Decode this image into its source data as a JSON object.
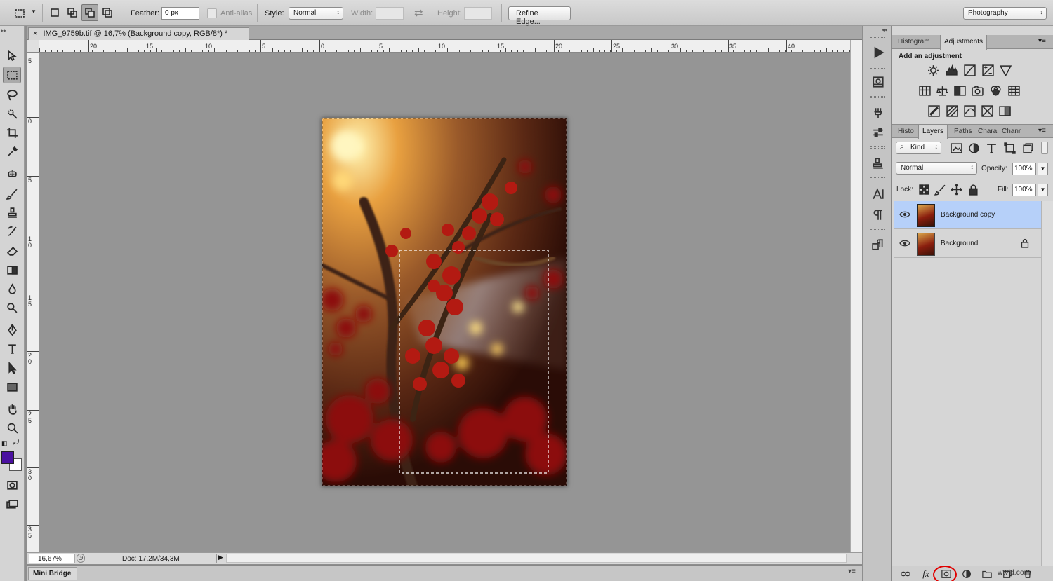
{
  "options_bar": {
    "feather_label": "Feather:",
    "feather_value": "0 px",
    "antialias_label": "Anti-alias",
    "style_label": "Style:",
    "style_value": "Normal",
    "width_label": "Width:",
    "height_label": "Height:",
    "refine_edge_label": "Refine Edge...",
    "workspace_value": "Photography"
  },
  "document": {
    "tab_title": "IMG_9759b.tif @ 16,7% (Background copy, RGB/8*) *",
    "close_glyph": "×",
    "zoom_value": "16,67%",
    "doc_info": "Doc: 17,2M/34,3M",
    "horizontal_ruler": [
      "20",
      "15",
      "10",
      "5",
      "0",
      "5",
      "10",
      "15",
      "20",
      "25",
      "30",
      "35",
      "40"
    ],
    "vertical_ruler": [
      "5",
      "0",
      "5",
      "1 0",
      "1 5",
      "2 0",
      "2 5",
      "3 0",
      "3 5"
    ]
  },
  "bottom_panel": {
    "mini_bridge_label": "Mini Bridge"
  },
  "adjustments_panel": {
    "tabs": [
      "Histogram",
      "Adjustments"
    ],
    "active_tab": "Adjustments",
    "heading": "Add an adjustment"
  },
  "layers_panel": {
    "tabs": [
      "Histo",
      "Layers",
      "Paths",
      "Chara",
      "Chanr"
    ],
    "active_tab": "Layers",
    "filter_kind": "Kind",
    "blend_mode": "Normal",
    "opacity_label": "Opacity:",
    "opacity_value": "100%",
    "lock_label": "Lock:",
    "fill_label": "Fill:",
    "fill_value": "100%",
    "layers": [
      {
        "name": "Background copy",
        "selected": true,
        "locked": false
      },
      {
        "name": "Background",
        "selected": false,
        "locked": true
      }
    ]
  },
  "colors": {
    "foreground": "#4a10a0",
    "background": "#ffffff",
    "selected_layer": "#b6d0f9",
    "highlight_circle": "#e00000"
  },
  "watermark": "wtvid.com"
}
